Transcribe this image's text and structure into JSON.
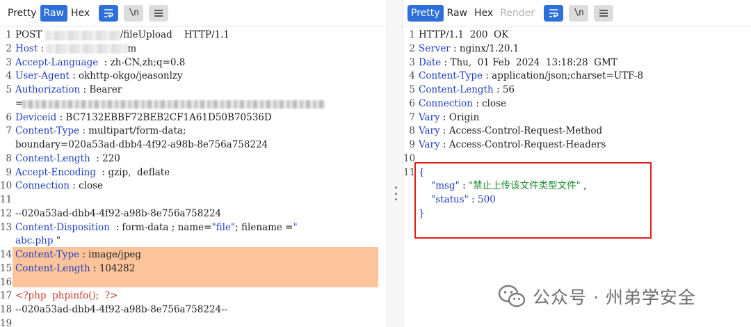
{
  "request_pane": {
    "tabs": [
      {
        "label": "Pretty",
        "active": false
      },
      {
        "label": "Raw",
        "active": true
      },
      {
        "label": "Hex",
        "active": false
      }
    ],
    "lines": [
      {
        "num": "1",
        "text": "POST ",
        "tail": "/fileUpload    HTTP/1.1"
      },
      {
        "num": "2",
        "key": "Host",
        "sep": " : ",
        "tail": "m"
      },
      {
        "num": "3",
        "key": "Accept-Language",
        "sep": "  : ",
        "value": "zh-CN,zh;q=0.8"
      },
      {
        "num": "4",
        "key": "User-Agent",
        "sep": " : ",
        "value": "okhttp-okgo/jeasonlzy"
      },
      {
        "num": "5",
        "key": "Authorization",
        "sep": " : ",
        "value": "Bearer"
      },
      {
        "num": "",
        "value": "="
      },
      {
        "num": "6",
        "key": "Deviceid",
        "sep": " : ",
        "value": "BC7132EBBF72BEB2CF1A61D50B70536D"
      },
      {
        "num": "7",
        "key": "Content-Type",
        "sep": " : ",
        "value": "multipart/form-data;"
      },
      {
        "num": "",
        "value": "boundary=020a53ad-dbb4-4f92-a98b-8e756a758224"
      },
      {
        "num": "8",
        "key": "Content-Length",
        "sep": "  : ",
        "value": "220"
      },
      {
        "num": "9",
        "key": "Accept-Encoding",
        "sep": "  : ",
        "value": "gzip,  deflate"
      },
      {
        "num": "10",
        "key": "Connection",
        "sep": " : ",
        "value": "close"
      },
      {
        "num": "11",
        "value": ""
      },
      {
        "num": "12",
        "value": "--020a53ad-dbb4-4f92-a98b-8e756a758224"
      },
      {
        "num": "13",
        "key": "Content-Disposition",
        "sep": "  : ",
        "value": "form-data ; name=",
        "q1": "\"file\"",
        "mid": "; filename =",
        "q2": "\""
      },
      {
        "num": "",
        "key": "abc.php",
        "value": " \""
      },
      {
        "num": "14",
        "key": "Content-Type",
        "sep": " : ",
        "value": "image/jpeg"
      },
      {
        "num": "15",
        "key": "Content-Length",
        "sep": " : ",
        "value": "104282"
      },
      {
        "num": "16",
        "value": ""
      },
      {
        "num": "17",
        "php": "<?php  phpinfo();  ?>"
      },
      {
        "num": "18",
        "value": "--020a53ad-dbb4-4f92-a98b-8e756a758224--"
      },
      {
        "num": "19",
        "value": ""
      }
    ]
  },
  "response_pane": {
    "tabs": [
      {
        "label": "Pretty",
        "active": true
      },
      {
        "label": "Raw",
        "active": false
      },
      {
        "label": "Hex",
        "active": false
      },
      {
        "label": "Render",
        "active": false
      }
    ],
    "lines": [
      {
        "num": "1",
        "value": "HTTP/1.1  200  OK"
      },
      {
        "num": "2",
        "key": "Server",
        "sep": " : ",
        "value": "nginx/1.20.1"
      },
      {
        "num": "3",
        "key": "Date",
        "sep": " : ",
        "value": "Thu,  01 Feb  2024  13:18:28  GMT"
      },
      {
        "num": "4",
        "key": "Content-Type",
        "sep": " : ",
        "value": "application/json;charset=UTF-8"
      },
      {
        "num": "5",
        "key": "Content-Length",
        "sep": " : ",
        "value": "56"
      },
      {
        "num": "6",
        "key": "Connection",
        "sep": " : ",
        "value": "close"
      },
      {
        "num": "7",
        "key": "Vary",
        "sep": " : ",
        "value": "Origin"
      },
      {
        "num": "8",
        "key": "Vary",
        "sep": " : ",
        "value": "Access-Control-Request-Method"
      },
      {
        "num": "9",
        "key": "Vary",
        "sep": " : ",
        "value": "Access-Control-Request-Headers"
      },
      {
        "num": "10",
        "value": ""
      },
      {
        "num": "11",
        "brace": "{"
      },
      {
        "num": "",
        "jkey": "\"msg\"",
        "jsep": " : ",
        "jstr": "\"禁止上传该文件类型文件\"",
        "jtail": " ,"
      },
      {
        "num": "",
        "jkey": "\"status\"",
        "jsep": " : ",
        "jnum": "500"
      },
      {
        "num": "",
        "brace": "}"
      }
    ]
  },
  "watermark": {
    "text": "公众号 · 州弟学安全"
  },
  "colors": {
    "accent": "#2e6fd9",
    "key": "#1f3fbf",
    "string": "#1a8a2a",
    "php": "#c0392b",
    "highlight": "#fcc49b",
    "box": "#e41b1b"
  }
}
